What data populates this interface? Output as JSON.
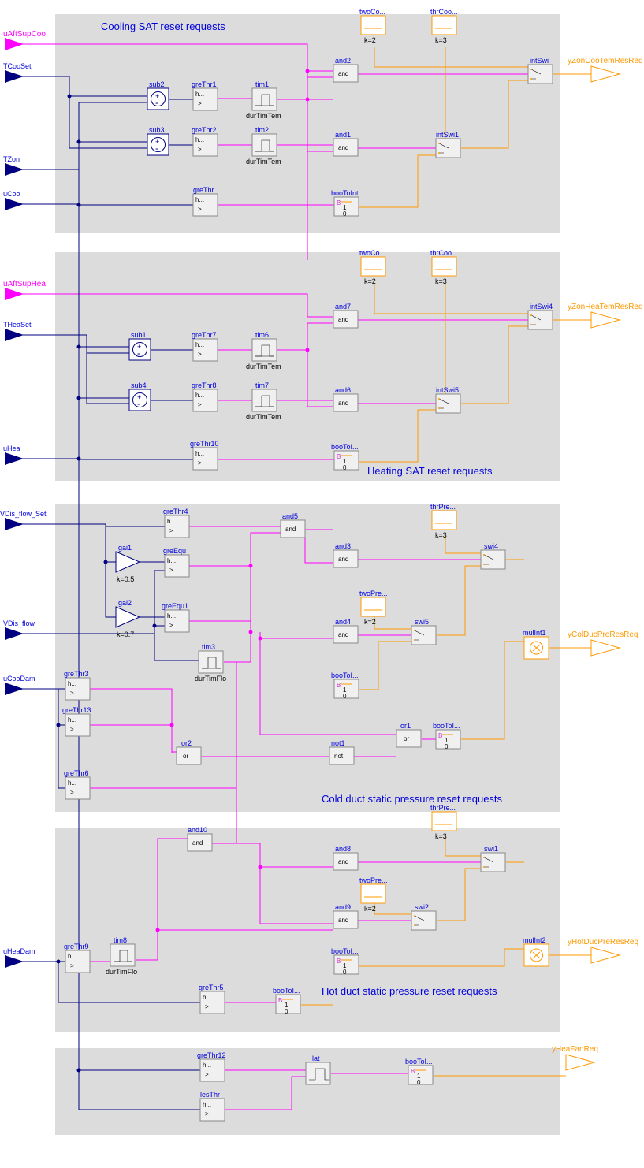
{
  "sections": {
    "cool": "Cooling SAT reset requests",
    "heat": "Heating SAT reset requests",
    "cold": "Cold duct static pressure reset requests",
    "hot": "Hot duct static pressure reset requests"
  },
  "inputs": {
    "uAftSupCoo": "uAftSupCoo",
    "TCooSet": "TCooSet",
    "TZon": "TZon",
    "uCoo": "uCoo",
    "uAftSupHea": "uAftSupHea",
    "THeaSet": "THeaSet",
    "uHea": "uHea",
    "VDis_flow_Set": "VDis_flow_Set",
    "VDis_flow": "VDis_flow",
    "uCooDam": "uCooDam",
    "uHeaDam": "uHeaDam"
  },
  "outputs": {
    "yZonCooTemResReq": "yZonCooTemResReq",
    "yZonHeaTemResReq": "yZonHeaTemResReq",
    "yColDucPreResReq": "yColDucPreResReq",
    "yHotDucPreResReq": "yHotDucPreResReq",
    "yHeaFanReq": "yHeaFanReq"
  },
  "constants": {
    "twoCo": {
      "label": "twoCo...",
      "k": "k=2"
    },
    "thrCoo": {
      "label": "thrCoo...",
      "k": "k=3"
    },
    "twoCo2": {
      "label": "twoCo...",
      "k": "k=2"
    },
    "thrCoo2": {
      "label": "thrCoo...",
      "k": "k=3"
    },
    "thrPre": {
      "label": "thrPre...",
      "k": "k=3"
    },
    "twoPre": {
      "label": "twoPre...",
      "k": "k=2"
    },
    "thrPre2": {
      "label": "thrPre...",
      "k": "k=3"
    },
    "twoPre2": {
      "label": "twoPre...",
      "k": "k=2"
    }
  },
  "blocks": {
    "sub1": "sub1",
    "sub2": "sub2",
    "sub3": "sub3",
    "sub4": "sub4",
    "gai1": "gai1",
    "gai1k": "k=0.5",
    "gai2": "gai2",
    "gai2k": "k=0.7",
    "greThr": "greThr",
    "greThr1": "greThr1",
    "greThr2": "greThr2",
    "greThr3": "greThr3",
    "greThr4": "greThr4",
    "greThr5": "greThr5",
    "greThr6": "greThr6",
    "greThr7": "greThr7",
    "greThr8": "greThr8",
    "greThr9": "greThr9",
    "greThr10": "greThr10",
    "greThr12": "greThr12",
    "greThr13": "greThr13",
    "lesThr": "lesThr",
    "greEqu": "greEqu",
    "greEqu1": "greEqu1",
    "tim1": "tim1",
    "tim2": "tim2",
    "tim3": "tim3",
    "tim6": "tim6",
    "tim7": "tim7",
    "tim8": "tim8",
    "durTimTem": "durTimTem",
    "durTimFlo": "durTimFlo",
    "and1": "and1",
    "and2": "and2",
    "and3": "and3",
    "and4": "and4",
    "and5": "and5",
    "and6": "and6",
    "and7": "and7",
    "and8": "and8",
    "and9": "and9",
    "and10": "and10",
    "or1": "or1",
    "or2": "or2",
    "not1": "not1",
    "lat": "lat",
    "booToInt": "booToInt",
    "booToI": "booToI...",
    "intSwi": "intSwi",
    "intSwi1": "intSwi1",
    "intSwi4": "intSwi4",
    "intSwi5": "intSwi5",
    "swi1": "swi1",
    "swi2": "swi2",
    "swi4": "swi4",
    "swi5": "swi5",
    "mulInt1": "mulInt1",
    "mulInt2": "mulInt2",
    "gt": ">",
    "h": "h...",
    "and": "and",
    "or": "or",
    "not": "not",
    "one": "1",
    "zero": "0",
    "B": "B"
  }
}
